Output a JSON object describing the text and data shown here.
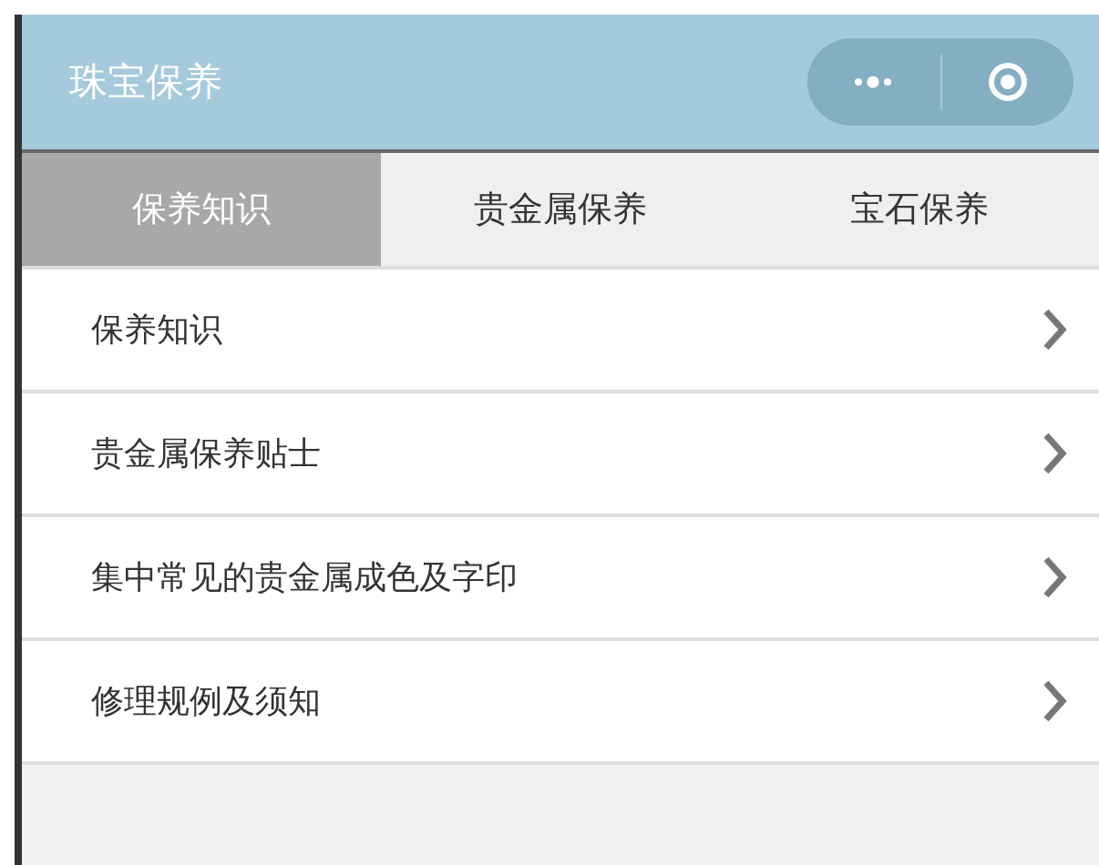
{
  "header": {
    "title": "珠宝保养"
  },
  "tabs": [
    {
      "label": "保养知识",
      "selected": true
    },
    {
      "label": "贵金属保养",
      "selected": false
    },
    {
      "label": "宝石保养",
      "selected": false
    }
  ],
  "items": [
    {
      "label": "保养知识"
    },
    {
      "label": "贵金属保养贴士"
    },
    {
      "label": "集中常见的贵金属成色及字印"
    },
    {
      "label": "修理规例及须知"
    }
  ]
}
